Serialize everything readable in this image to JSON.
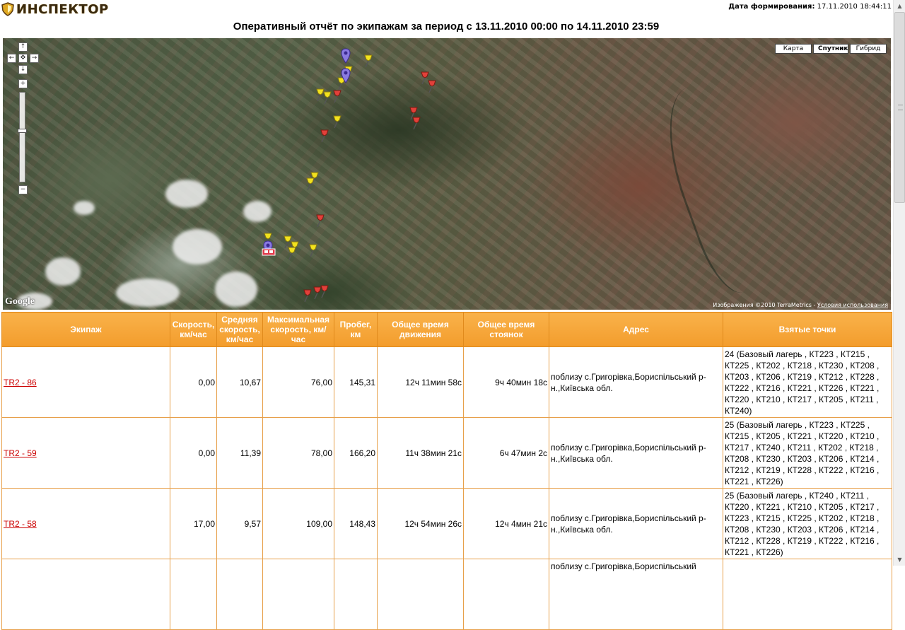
{
  "header": {
    "logo_text": "ИНСПЕКТОР",
    "gen_label": "Дата формирования:",
    "gen_value": "17.11.2010 18:44:11",
    "title": "Оперативный отчёт по экипажам за период с 13.11.2010 00:00 по 14.11.2010 23:59"
  },
  "map": {
    "types": [
      "Карта",
      "Спутник",
      "Гибрид"
    ],
    "selected_type": "Спутник",
    "google_text": "Google",
    "attribution": "Изображения ©2010 TerraMetrics - ",
    "terms_link": "Условия использования",
    "zoom_controls": {
      "up": "↑",
      "left": "←",
      "center": "✥",
      "right": "→",
      "down": "↓",
      "plus": "+",
      "minus": "−"
    }
  },
  "table": {
    "columns": [
      "Экипаж",
      "Скорость, км/час",
      "Средняя скорость, км/час",
      "Максимальная скорость, км/час",
      "Пробег, км",
      "Общее время движения",
      "Общее время стоянок",
      "Адрес",
      "Взятые точки"
    ],
    "rows": [
      {
        "crew": "TR2 - 86",
        "speed": "0,00",
        "avg": "10,67",
        "max": "76,00",
        "mileage": "145,31",
        "move": "12ч 11мин 58с",
        "stop": "9ч 40мин 18с",
        "address": "поблизу с.Григорівка,Бориспільський р-н.,Київська обл.",
        "points": "24 (Базовый лагерь , КТ223 , КТ215 , КТ225 , КТ202 , КТ218 , КТ230 , КТ208 , КТ203 , КТ206 , КТ219 , КТ212 , КТ228 , КТ222 , КТ216 , КТ221 , КТ226 , КТ221 , КТ220 , КТ210 , КТ217 , КТ205 , КТ211 , КТ240)"
      },
      {
        "crew": "TR2 - 59",
        "speed": "0,00",
        "avg": "11,39",
        "max": "78,00",
        "mileage": "166,20",
        "move": "11ч 38мин 21с",
        "stop": "6ч 47мин 2с",
        "address": "поблизу с.Григорівка,Бориспільський р-н.,Київська обл.",
        "points": "25 (Базовый лагерь , КТ223 , КТ225 , КТ215 , КТ205 , КТ221 , КТ220 , КТ210 , КТ217 , КТ240 , КТ211 , КТ202 , КТ218 , КТ208 , КТ230 , КТ203 , КТ206 , КТ214 , КТ212 , КТ219 , КТ228 , КТ222 , КТ216 , КТ221 , КТ226)"
      },
      {
        "crew": "TR2 - 58",
        "speed": "17,00",
        "avg": "9,57",
        "max": "109,00",
        "mileage": "148,43",
        "move": "12ч 54мин 26с",
        "stop": "12ч 4мин 21с",
        "address": "поблизу с.Григорівка,Бориспільський р-н.,Київська обл.",
        "points": "25 (Базовый лагерь , КТ240 , КТ211 , КТ220 , КТ221 , КТ210 , КТ205 , КТ217 , КТ223 , КТ215 , КТ225 , КТ202 , КТ218 , КТ208 , КТ230 , КТ203 , КТ206 , КТ214 , КТ212 , КТ228 , КТ219 , КТ222 , КТ216 , КТ221 , КТ226)"
      },
      {
        "crew": "",
        "speed": "",
        "avg": "",
        "max": "",
        "mileage": "",
        "move": "",
        "stop": "",
        "address": "поблизу с.Григорівка,Бориспільський",
        "points": ""
      }
    ]
  },
  "colors": {
    "header_orange": "#f39c2c",
    "link_red": "#cc0000",
    "pin_yellow": "#f2e21e",
    "pin_red": "#e2403a",
    "pin_blue": "#8a7ae0"
  },
  "icons": [
    "logo-shield-icon",
    "pushpin-icon",
    "map-marker-icon",
    "vehicle-icon"
  ]
}
